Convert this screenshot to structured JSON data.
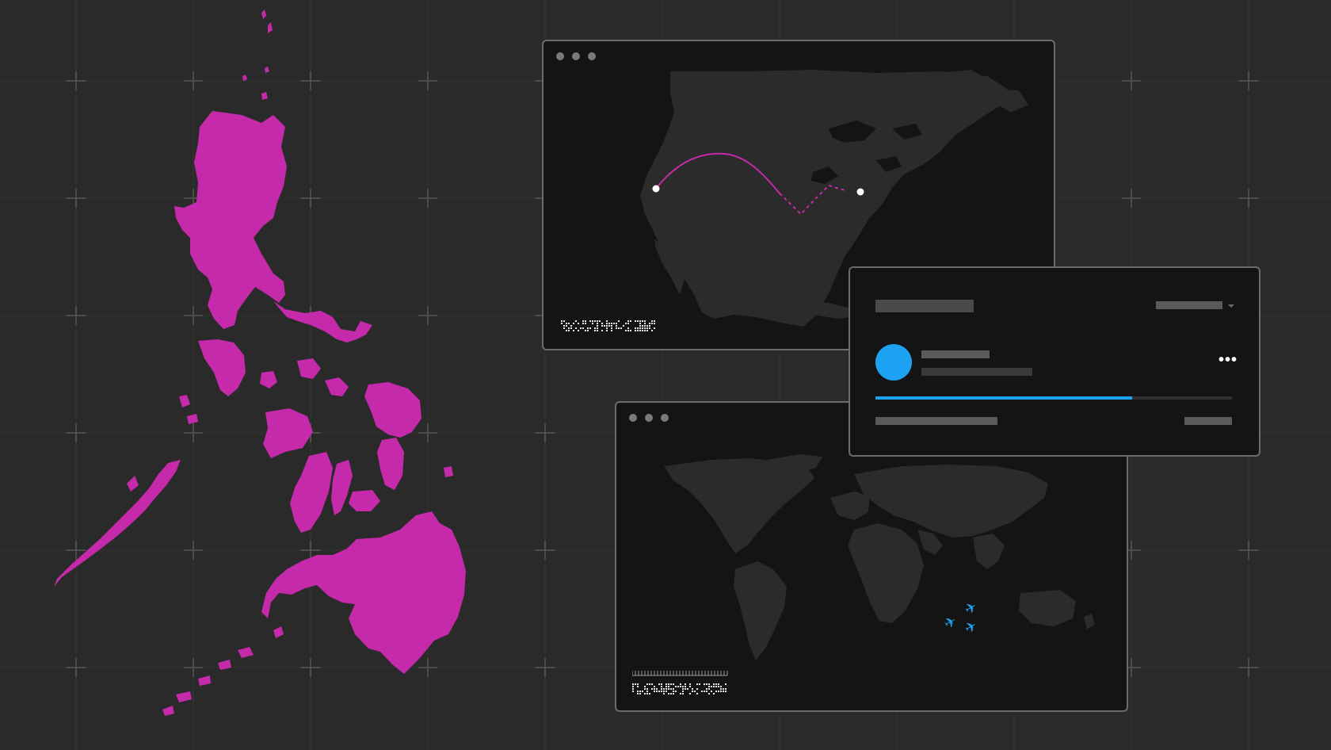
{
  "colors": {
    "background": "#2a2a2b",
    "panel": "#141414",
    "land": "#2b2b2b",
    "accent_magenta": "#c42aa9",
    "accent_blue": "#1da1f2",
    "placeholder_bar": "#4a4a4a"
  },
  "windows": [
    {
      "name": "north-america-route-window",
      "content": "route-map",
      "route": {
        "style_solid": "solid",
        "style_dashed": "dashed"
      }
    },
    {
      "name": "world-flights-window",
      "content": "world-map",
      "plane_icon": "airplane-icon",
      "plane_count": 3
    }
  ],
  "card": {
    "avatar_color": "#1da1f2",
    "more_icon": "ellipsis-icon",
    "dropdown_icon": "chevron-down-icon",
    "more_label": "•••",
    "plane_glyph": "✈",
    "progress": 0.72
  }
}
